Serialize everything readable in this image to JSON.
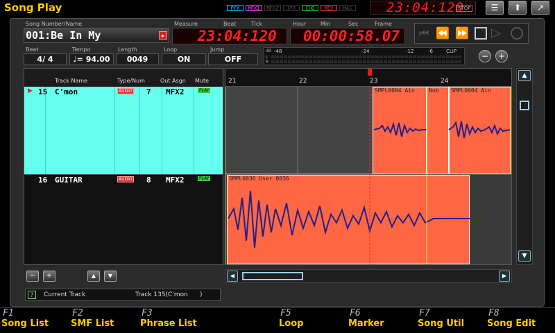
{
  "app": {
    "title": "Song Play"
  },
  "fx_indicators": [
    {
      "label": "PFX",
      "color": "#00c8ff"
    },
    {
      "label": "MFX1",
      "color": "#ff40ff"
    },
    {
      "label": "MFX2",
      "color": "#888888"
    },
    {
      "label": "IFX",
      "color": "#888888"
    },
    {
      "label": "CHO",
      "color": "#33cc33"
    },
    {
      "label": "REV",
      "color": "#ff3333"
    },
    {
      "label": "MAS",
      "color": "#888888"
    }
  ],
  "clock": {
    "value": "23:04:120",
    "stop": "STOP"
  },
  "song": {
    "label": "Song Number/Name",
    "value": "001:Be In My"
  },
  "position": {
    "measure_label": "Measure",
    "beat_label": "Beat",
    "tick_label": "Tick",
    "value": "23:04:120",
    "hour_label": "Hour",
    "min_label": "Min",
    "sec_label": "Sec",
    "frame_label": "Frame",
    "time": "00:00:58.07"
  },
  "params": {
    "beat": {
      "label": "Beat",
      "value": "4/ 4"
    },
    "tempo": {
      "label": "Tempo",
      "value": "♩= 94.00"
    },
    "length": {
      "label": "Length",
      "value": "0049"
    },
    "loop": {
      "label": "Loop",
      "value": "ON"
    },
    "jump": {
      "label": "Jump",
      "value": "OFF"
    }
  },
  "meter": {
    "db": "dB",
    "l": "L",
    "r": "R",
    "ticks": [
      "-48",
      "-24",
      "-12",
      "-6",
      "CLIP"
    ]
  },
  "headers": {
    "track_name": "Track Name",
    "type_num": "Type/Num",
    "out_asgn": "Out Asgn",
    "mute": "Mute"
  },
  "tracks": [
    {
      "num": "15",
      "name": "C'mon",
      "type": "AUDIO",
      "type_num": "7",
      "out": "MFX2",
      "mute": "PLAY"
    },
    {
      "num": "16",
      "name": "GUITAR",
      "type": "AUDIO",
      "type_num": "8",
      "out": "MFX2",
      "mute": "PLAY"
    }
  ],
  "measures": [
    "21",
    "22",
    "23",
    "24"
  ],
  "clips": [
    {
      "label": "SMPL0004 Ain"
    },
    {
      "label": "Nob"
    },
    {
      "label": "SMPL0004 Ain"
    },
    {
      "label": "SMPL0036 User 0036"
    }
  ],
  "current_track": {
    "label": "Current Track",
    "value": "Track 135(C'mon      )"
  },
  "fkeys": [
    {
      "num": "F1",
      "label": "Song List"
    },
    {
      "num": "F2",
      "label": "SMF List"
    },
    {
      "num": "F3",
      "label": "Phrase List"
    },
    {
      "num": "F4",
      "label": ""
    },
    {
      "num": "F5",
      "label": "Loop"
    },
    {
      "num": "F6",
      "label": "Marker"
    },
    {
      "num": "F7",
      "label": "Song Util"
    },
    {
      "num": "F8",
      "label": "Song Edit"
    }
  ],
  "colors": {
    "accent": "#ffcc00",
    "led": "#ff2020",
    "selected_row": "#66ffee",
    "clip": "#ff6644",
    "wave": "#22208a"
  }
}
